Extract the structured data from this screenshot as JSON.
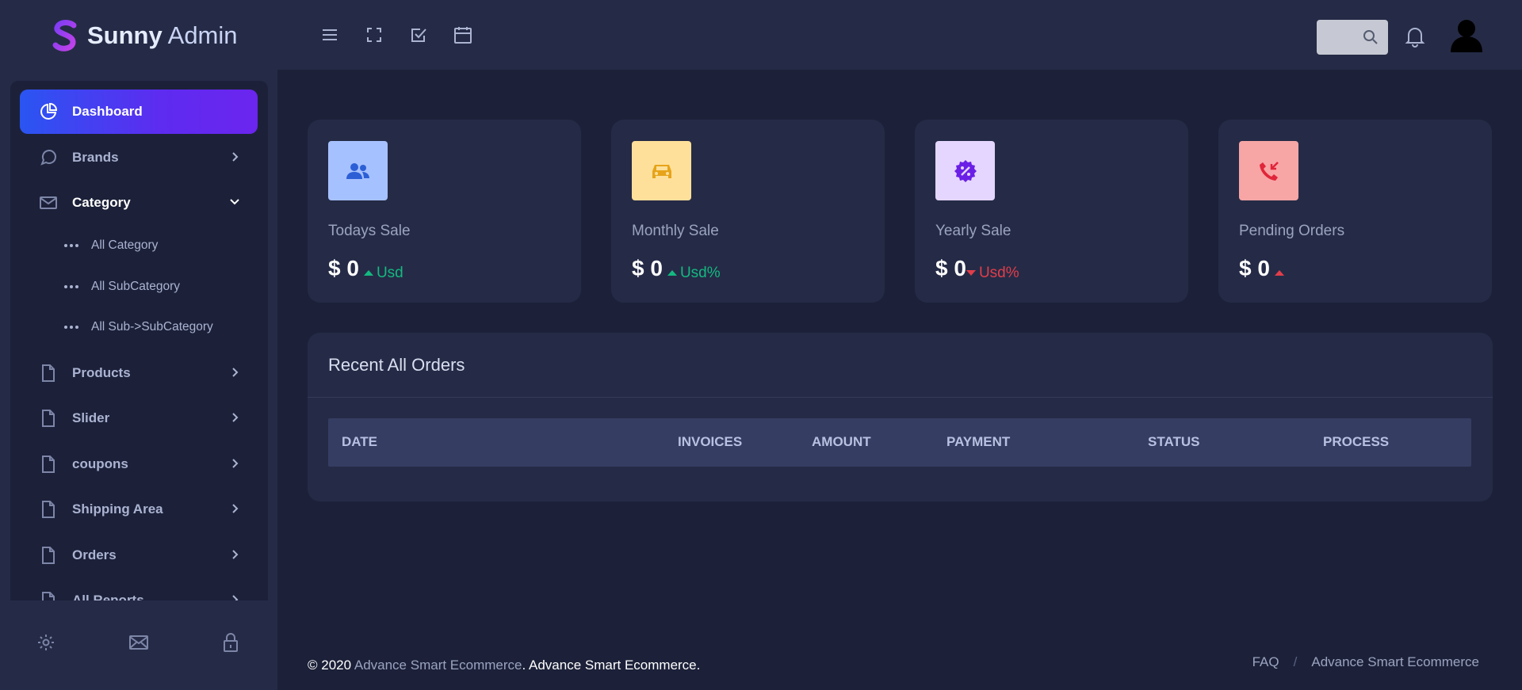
{
  "app": {
    "brand_bold": "Sunny",
    "brand_light": "Admin"
  },
  "header": {
    "toolbar_icons": [
      "menu-icon",
      "fullscreen-icon",
      "checkbox-icon",
      "calendar-icon"
    ],
    "search": {
      "placeholder": "",
      "value": ""
    },
    "icons": [
      "search-icon",
      "bell-icon",
      "user-avatar"
    ]
  },
  "sidebar": {
    "items": [
      {
        "label": "Dashboard",
        "icon": "pie-chart-icon",
        "active": true
      },
      {
        "label": "Brands",
        "icon": "chat-icon"
      },
      {
        "label": "Category",
        "icon": "mail-icon",
        "open": true
      },
      {
        "label": "Products",
        "icon": "file-icon"
      },
      {
        "label": "Slider",
        "icon": "file-icon"
      },
      {
        "label": "coupons",
        "icon": "file-icon"
      },
      {
        "label": "Shipping Area",
        "icon": "file-icon"
      },
      {
        "label": "Orders",
        "icon": "file-icon"
      },
      {
        "label": "All Reports",
        "icon": "file-icon"
      }
    ],
    "subitems": [
      {
        "label": "All Category"
      },
      {
        "label": "All SubCategory"
      },
      {
        "label": "All Sub->SubCategory"
      }
    ],
    "footer_icons": [
      "settings-icon",
      "mail-icon",
      "lock-icon"
    ]
  },
  "cards": [
    {
      "title": "Todays Sale",
      "amount": "$ 0",
      "trend": "Usd",
      "trend_dir": "up",
      "trend_color": "#14b981",
      "icon_bg": "#a6c1ff",
      "icon": "users-icon"
    },
    {
      "title": "Monthly Sale",
      "amount": "$ 0",
      "trend": "Usd%",
      "trend_dir": "up",
      "trend_color": "#14b981",
      "icon_bg": "#ffe09a",
      "icon": "car-icon"
    },
    {
      "title": "Yearly Sale",
      "amount": "$ 0",
      "trend": "Usd%",
      "trend_dir": "down",
      "trend_color": "#e23d4b",
      "icon_bg": "#e5d6ff",
      "icon": "discount-icon"
    },
    {
      "title": "Pending Orders",
      "amount": "$ 0",
      "trend": "",
      "trend_dir": "up",
      "trend_color": "#e23d4b",
      "icon_bg": "#f8a5a6",
      "icon": "phone-incoming-icon"
    }
  ],
  "orders": {
    "title": "Recent All Orders",
    "columns": [
      "DATE",
      "INVOICES",
      "AMOUNT",
      "PAYMENT",
      "STATUS",
      "PROCESS"
    ],
    "rows": []
  },
  "footer": {
    "copyright_prefix": "© 2020 ",
    "copyright_link": "Advance Smart Ecommerce",
    "copyright_suffix": ". Advance Smart Ecommerce.",
    "links": [
      "FAQ",
      "Advance Smart Ecommerce"
    ],
    "separator": "/"
  },
  "colors": {
    "accent_gradient_start": "#2a55f2",
    "accent_gradient_end": "#6b25ee",
    "bg": "#1c2139",
    "panel": "#252b46"
  }
}
